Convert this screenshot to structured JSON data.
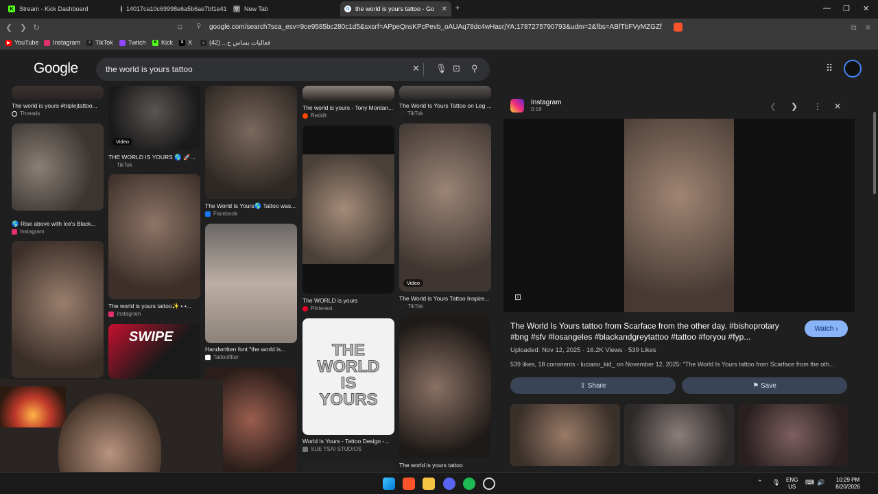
{
  "tabs": [
    {
      "title": "Stream - Kick Dashboard",
      "icon": "kick-icon",
      "color": "#53fc18"
    },
    {
      "title": "14017ca10c69998e6a5b6ae7bf1e415",
      "icon": "globe-icon",
      "color": "#aaaaaa"
    },
    {
      "title": "New Tab",
      "icon": "brave-icon",
      "color": "#aaaaaa"
    },
    {
      "title": "the world is yours tattoo - Goog",
      "icon": "google-icon",
      "color": "#ffffff"
    }
  ],
  "address": {
    "url": "google.com/search?sca_esv=9ce9585bc280c1d5&sxsrf=APpeQnsKPcPevb_oAUAq78dc4wHasrjYA:1787275790793&udm=2&fbs=ABfTbFVyMZGZf1hfvX9uKjN..."
  },
  "bookmarks": [
    {
      "label": "YouTube",
      "color": "#ff0000",
      "icon": "youtube-icon"
    },
    {
      "label": "Instagram",
      "color": "#e1306c",
      "icon": "instagram-icon"
    },
    {
      "label": "TikTok",
      "color": "#222222",
      "icon": "tiktok-icon"
    },
    {
      "label": "Twitch",
      "color": "#9146ff",
      "icon": "twitch-icon"
    },
    {
      "label": "Kick",
      "color": "#53fc18",
      "icon": "kick-icon"
    },
    {
      "label": "X",
      "color": "#000000",
      "icon": "x-icon"
    },
    {
      "label": "فعالیات بساس ح... (42)",
      "color": "#222222",
      "icon": "tiktok-icon"
    }
  ],
  "google": {
    "logo": "Google",
    "query": "the world is yours tattoo"
  },
  "results": {
    "col1": [
      {
        "caption": "The world is yours #triplejtattoo...",
        "source": "Threads",
        "src_color": "#ffffff"
      },
      {
        "caption": "🌎 Rise above with Ice's Black...",
        "source": "Instagram",
        "src_color": "#e1306c"
      }
    ],
    "col2": [
      {
        "caption": "THE WORLD IS YOURS 🌎 🚀...",
        "source": "TikTok",
        "src_color": "#ffffff",
        "badge": "Video"
      },
      {
        "caption": "The world is yours tattoo✨ • •...",
        "source": "Instagram",
        "src_color": "#e1306c"
      },
      {
        "caption": "SWIPE",
        "source": "",
        "src_color": "#ffffff"
      }
    ],
    "col3": [
      {
        "caption": "The World Is Yours🌎 Tattoo was...",
        "source": "Facebook",
        "src_color": "#1877f2"
      },
      {
        "caption": "Handwritten font \"the world is...",
        "source": "Tattoofilter",
        "src_color": "#ffffff"
      }
    ],
    "col4": [
      {
        "caption": "The world is yours - Tony Montan...",
        "source": "Reddit",
        "src_color": "#ff4500"
      },
      {
        "caption": "The WORLD is yours",
        "source": "Pinterest",
        "src_color": "#e60023"
      },
      {
        "caption": "World Is Yours - Tattoo Design -...",
        "source": "SUE TSAI STUDIOS",
        "src_color": "#aaaaaa",
        "art": "THE WORLD IS YOURS"
      }
    ],
    "col5": [
      {
        "caption": "The World Is Yours Tattoo on Leg ...",
        "source": "TikTok",
        "src_color": "#ffffff"
      },
      {
        "caption": "The World is Yours Tattoo Inspire...",
        "source": "TikTok",
        "src_color": "#ffffff",
        "badge": "Video"
      },
      {
        "caption": "The world is yours tattoo",
        "source": "",
        "src_color": "#ffffff"
      }
    ]
  },
  "panel": {
    "source": "Instagram",
    "duration": "0:18",
    "title": "The World Is Yours tattoo from Scarface from the other day. #bishoprotary #bng #sfv #losangeles #blackandgreytattoo #tattoo #foryou #fyp...",
    "watch": "Watch",
    "uploaded": "Uploaded: Nov 12, 2025 · 16.2K Views · 539 Likes",
    "description": "539 likes, 18 comments - luciano_kid_ on November 12, 2025: \"The World Is Yours tattoo from Scarface from the oth...",
    "share": "Share",
    "save": "Save"
  },
  "tray": {
    "lang_top": "ENG",
    "lang_bottom": "US",
    "time": "10:29 PM",
    "date": "8/20/2026"
  }
}
